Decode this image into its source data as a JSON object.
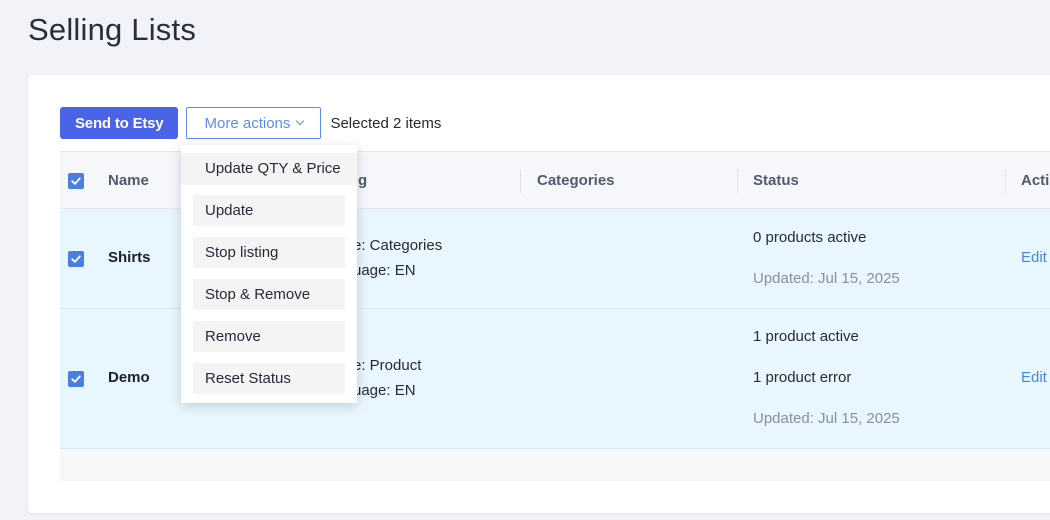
{
  "page": {
    "title": "Selling Lists"
  },
  "toolbar": {
    "send_label": "Send to Etsy",
    "more_label": "More actions",
    "selected_text": "Selected 2 items"
  },
  "table": {
    "headers": {
      "name": "Name",
      "listing": "g",
      "categories": "Categories",
      "status": "Status",
      "actions": "Actio"
    },
    "rows": [
      {
        "name": "Shirts",
        "listing_line1": "e: Categories",
        "listing_line2": "uage: EN",
        "status_lines": [
          "0 products active"
        ],
        "updated": "Updated: Jul 15, 2025",
        "action": "Edit"
      },
      {
        "name": "Demo",
        "listing_line1": "e: Product",
        "listing_line2": "uage: EN",
        "status_lines": [
          "1 product active",
          "1 product error"
        ],
        "updated": "Updated: Jul 15, 2025",
        "action": "Edit"
      }
    ]
  },
  "dropdown": {
    "items": [
      "Update QTY & Price",
      "Update",
      "Stop listing",
      "Stop & Remove",
      "Remove",
      "Reset Status"
    ]
  },
  "colors": {
    "primary": "#4a63e7",
    "accent": "#5b8def",
    "row_selected": "#e8f6fd",
    "checkbox": "#4a7fe0"
  }
}
